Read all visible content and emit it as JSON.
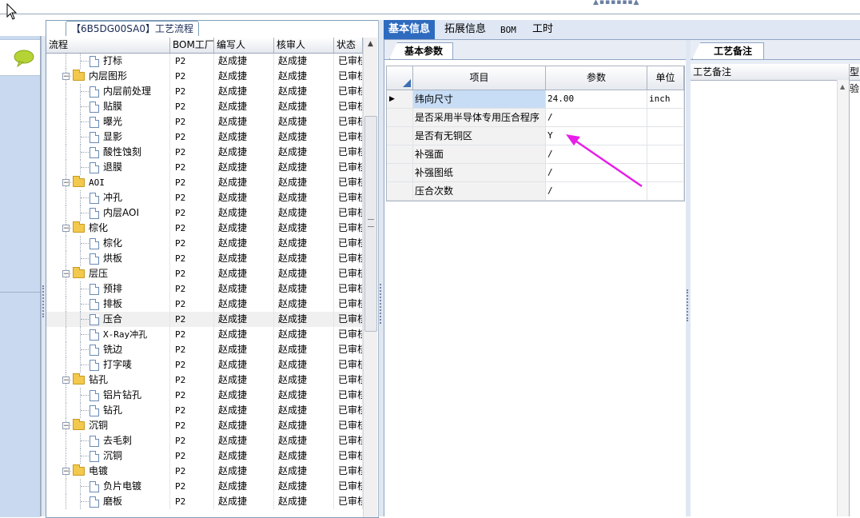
{
  "tree_panel": {
    "title": "【6B5DG00SA0】工艺流程",
    "columns": [
      "流程",
      "BOM工厂",
      "编写人",
      "核审人",
      "状态"
    ],
    "rows": [
      {
        "name": "打标",
        "type": "file",
        "level": 2,
        "bom": "P2",
        "writer": "赵成捷",
        "reviewer": "赵成捷",
        "status": "已审核"
      },
      {
        "name": "内层图形",
        "type": "folder",
        "level": 1,
        "bom": "P2",
        "writer": "赵成捷",
        "reviewer": "赵成捷",
        "status": "已审核"
      },
      {
        "name": "内层前处理",
        "type": "file",
        "level": 2,
        "bom": "P2",
        "writer": "赵成捷",
        "reviewer": "赵成捷",
        "status": "已审核"
      },
      {
        "name": "贴膜",
        "type": "file",
        "level": 2,
        "bom": "P2",
        "writer": "赵成捷",
        "reviewer": "赵成捷",
        "status": "已审核"
      },
      {
        "name": "曝光",
        "type": "file",
        "level": 2,
        "bom": "P2",
        "writer": "赵成捷",
        "reviewer": "赵成捷",
        "status": "已审核"
      },
      {
        "name": "显影",
        "type": "file",
        "level": 2,
        "bom": "P2",
        "writer": "赵成捷",
        "reviewer": "赵成捷",
        "status": "已审核"
      },
      {
        "name": "酸性蚀刻",
        "type": "file",
        "level": 2,
        "bom": "P2",
        "writer": "赵成捷",
        "reviewer": "赵成捷",
        "status": "已审核"
      },
      {
        "name": "退膜",
        "type": "file",
        "level": 2,
        "bom": "P2",
        "writer": "赵成捷",
        "reviewer": "赵成捷",
        "status": "已审核"
      },
      {
        "name": "AOI",
        "type": "folder",
        "level": 1,
        "bom": "P2",
        "writer": "赵成捷",
        "reviewer": "赵成捷",
        "status": "已审核"
      },
      {
        "name": "冲孔",
        "type": "file",
        "level": 2,
        "bom": "P2",
        "writer": "赵成捷",
        "reviewer": "赵成捷",
        "status": "已审核"
      },
      {
        "name": "内层AOI",
        "type": "file",
        "level": 2,
        "bom": "P2",
        "writer": "赵成捷",
        "reviewer": "赵成捷",
        "status": "已审核"
      },
      {
        "name": "棕化",
        "type": "folder",
        "level": 1,
        "bom": "P2",
        "writer": "赵成捷",
        "reviewer": "赵成捷",
        "status": "已审核"
      },
      {
        "name": "棕化",
        "type": "file",
        "level": 2,
        "bom": "P2",
        "writer": "赵成捷",
        "reviewer": "赵成捷",
        "status": "已审核"
      },
      {
        "name": "烘板",
        "type": "file",
        "level": 2,
        "bom": "P2",
        "writer": "赵成捷",
        "reviewer": "赵成捷",
        "status": "已审核"
      },
      {
        "name": "层压",
        "type": "folder",
        "level": 1,
        "bom": "P2",
        "writer": "赵成捷",
        "reviewer": "赵成捷",
        "status": "已审核"
      },
      {
        "name": "预排",
        "type": "file",
        "level": 2,
        "bom": "P2",
        "writer": "赵成捷",
        "reviewer": "赵成捷",
        "status": "已审核"
      },
      {
        "name": "排板",
        "type": "file",
        "level": 2,
        "bom": "P2",
        "writer": "赵成捷",
        "reviewer": "赵成捷",
        "status": "已审核"
      },
      {
        "name": "压合",
        "type": "file",
        "level": 2,
        "bom": "P2",
        "writer": "赵成捷",
        "reviewer": "赵成捷",
        "status": "已审核",
        "selected": true
      },
      {
        "name": "X-Ray冲孔",
        "type": "file",
        "level": 2,
        "bom": "P2",
        "writer": "赵成捷",
        "reviewer": "赵成捷",
        "status": "已审核"
      },
      {
        "name": "铣边",
        "type": "file",
        "level": 2,
        "bom": "P2",
        "writer": "赵成捷",
        "reviewer": "赵成捷",
        "status": "已审核"
      },
      {
        "name": "打字唛",
        "type": "file",
        "level": 2,
        "bom": "P2",
        "writer": "赵成捷",
        "reviewer": "赵成捷",
        "status": "已审核"
      },
      {
        "name": "钻孔",
        "type": "folder",
        "level": 1,
        "bom": "P2",
        "writer": "赵成捷",
        "reviewer": "赵成捷",
        "status": "已审核"
      },
      {
        "name": "铝片钻孔",
        "type": "file",
        "level": 2,
        "bom": "P2",
        "writer": "赵成捷",
        "reviewer": "赵成捷",
        "status": "已审核"
      },
      {
        "name": "钻孔",
        "type": "file",
        "level": 2,
        "bom": "P2",
        "writer": "赵成捷",
        "reviewer": "赵成捷",
        "status": "已审核"
      },
      {
        "name": "沉铜",
        "type": "folder",
        "level": 1,
        "bom": "P2",
        "writer": "赵成捷",
        "reviewer": "赵成捷",
        "status": "已审核"
      },
      {
        "name": "去毛刺",
        "type": "file",
        "level": 2,
        "bom": "P2",
        "writer": "赵成捷",
        "reviewer": "赵成捷",
        "status": "已审核"
      },
      {
        "name": "沉铜",
        "type": "file",
        "level": 2,
        "bom": "P2",
        "writer": "赵成捷",
        "reviewer": "赵成捷",
        "status": "已审核"
      },
      {
        "name": "电镀",
        "type": "folder",
        "level": 1,
        "bom": "P2",
        "writer": "赵成捷",
        "reviewer": "赵成捷",
        "status": "已审核"
      },
      {
        "name": "负片电镀",
        "type": "file",
        "level": 2,
        "bom": "P2",
        "writer": "赵成捷",
        "reviewer": "赵成捷",
        "status": "已审核"
      },
      {
        "name": "磨板",
        "type": "file",
        "level": 2,
        "bom": "P2",
        "writer": "赵成捷",
        "reviewer": "赵成捷",
        "status": "已审核"
      }
    ]
  },
  "main_tabs": [
    "基本信息",
    "拓展信息",
    "BOM",
    "工时"
  ],
  "params_panel": {
    "subtab": "基本参数",
    "columns": [
      "项目",
      "参数",
      "单位"
    ],
    "rows": [
      {
        "item": "纬向尺寸",
        "value": "24.00",
        "unit": "inch",
        "current": true
      },
      {
        "item": "是否采用半导体专用压合程序",
        "value": "/",
        "unit": ""
      },
      {
        "item": "是否有无铜区",
        "value": "Y",
        "unit": ""
      },
      {
        "item": "补强面",
        "value": "/",
        "unit": ""
      },
      {
        "item": "补强图纸",
        "value": "/",
        "unit": ""
      },
      {
        "item": "压合次数",
        "value": "/",
        "unit": ""
      }
    ],
    "arrow_color": "#e81ee8"
  },
  "notes_panel": {
    "subtab": "工艺备注",
    "column": "工艺备注",
    "extra_column": "型",
    "extra_value": "验"
  },
  "colors": {
    "tab_active": "#2e6bbf",
    "folder": "#f2c94c",
    "panel_bg": "#c9daf0"
  }
}
